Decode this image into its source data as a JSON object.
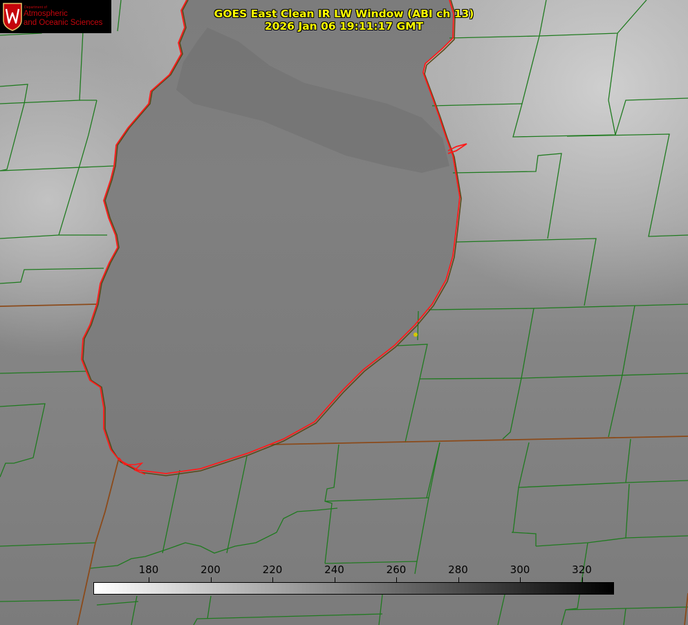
{
  "title": {
    "line1": "GOES East Clean IR LW Window (ABI ch 13)",
    "line2": "2026 Jan 06 19:11:17 GMT"
  },
  "logo": {
    "department": "Department of",
    "name": "Atmospheric\nand Oceanic Sciences",
    "seal_letter": "W"
  },
  "colorbar": {
    "ticks": [
      "180",
      "200",
      "220",
      "240",
      "260",
      "280",
      "300",
      "320"
    ],
    "gradient": [
      "#ffffff",
      "#000000"
    ]
  },
  "colors": {
    "county_lines": "#1f7a1f",
    "coastline": "#ff1a1a",
    "state_border": "#8b4a1a",
    "title_text": "#ffff00",
    "marker": "#d4c800",
    "logo_red": "#c5050c"
  }
}
